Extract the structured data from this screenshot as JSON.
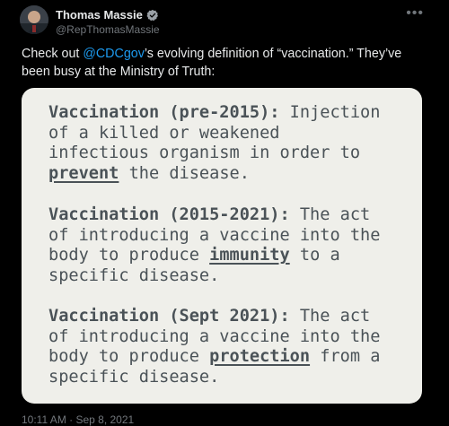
{
  "author": {
    "display_name": "Thomas Massie",
    "handle": "@RepThomasMassie",
    "verified": true
  },
  "more_icon": "•••",
  "tweet": {
    "text_before": "Check out ",
    "mention": "@CDCgov",
    "text_after": "’s evolving definition of “vaccination.” They’ve been busy at the Ministry of Truth:"
  },
  "card": {
    "background": "#efefea",
    "definitions": [
      {
        "term": "Vaccination (pre-2015):",
        "line1_rest": " Injection",
        "line2": "of a killed or weakened",
        "line3": "infectious organism in order to",
        "keyword": "prevent",
        "after_keyword": " the disease."
      },
      {
        "term": "Vaccination (2015-2021):",
        "line1_rest": " The act",
        "line2": "of introducing a vaccine into the",
        "before_keyword": "body to produce ",
        "keyword": "immunity",
        "after_keyword": " to a",
        "line4": "specific disease."
      },
      {
        "term": "Vaccination (Sept 2021):",
        "line1_rest": " The act",
        "line2": "of introducing a vaccine into the",
        "before_keyword": "body to produce ",
        "keyword": "protection",
        "after_keyword": " from a",
        "line4": "specific disease."
      }
    ]
  },
  "timestamp": "10:11 AM · Sep 8, 2021",
  "colors": {
    "background": "#000000",
    "text": "#e7e9ea",
    "secondary": "#71767b",
    "link": "#1d9bf0",
    "verified_badge": "#9aa0a6"
  }
}
